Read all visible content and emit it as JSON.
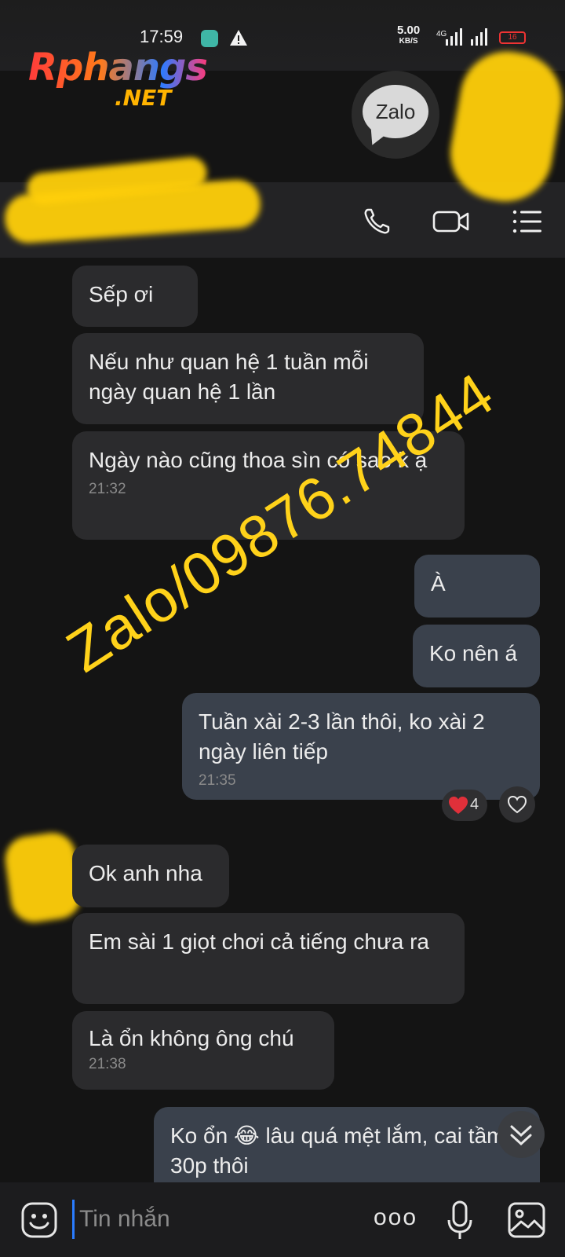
{
  "status_bar": {
    "time": "17:59",
    "speed_value": "5.00",
    "speed_unit": "KB/S",
    "network": "4G",
    "battery": "16"
  },
  "watermark": {
    "brand_main": "Rphangs",
    "brand_tld": ".NET",
    "zalo_badge": "Zalo",
    "overlay_text": "Zalo/09876.74844"
  },
  "header": {
    "icons": [
      "phone-icon",
      "video-call-icon",
      "menu-icon"
    ]
  },
  "messages": [
    {
      "dir": "in",
      "text": "Sếp ơi",
      "time": ""
    },
    {
      "dir": "in",
      "text": "Nếu như quan hệ 1 tuần mỗi ngày quan hệ 1 lần",
      "time": ""
    },
    {
      "dir": "in",
      "text": "Ngày nào cũng thoa sìn có sao k ạ",
      "time": "21:32"
    },
    {
      "dir": "out",
      "text": "À",
      "time": ""
    },
    {
      "dir": "out",
      "text": "Ko nên á",
      "time": ""
    },
    {
      "dir": "out",
      "text": "Tuần xài 2-3 lần thôi, ko xài 2 ngày liên tiếp",
      "time": "21:35"
    },
    {
      "dir": "in",
      "text": "Ok anh nha",
      "time": ""
    },
    {
      "dir": "in",
      "text": "Em sài 1 giọt chơi cả tiếng chưa ra",
      "time": ""
    },
    {
      "dir": "in",
      "text": "Là ổn không ông chú",
      "time": "21:38"
    },
    {
      "dir": "out",
      "text": "Ko ổn 😂 lâu quá mệt lắm, cai tầm 30p thôi",
      "time": ""
    }
  ],
  "reaction": {
    "emoji": "heart",
    "count": "4",
    "color": "#e0303a"
  },
  "input_bar": {
    "placeholder": "Tin nhắn",
    "more_label": "ooo",
    "icons": [
      "emoji-icon",
      "more-icon",
      "microphone-icon",
      "image-icon"
    ]
  },
  "colors": {
    "background": "#141414",
    "incoming_bubble": "#2b2b2d",
    "outgoing_bubble": "#3a414c",
    "overlay_yellow": "#ffd21a",
    "caret": "#2a7cff"
  }
}
